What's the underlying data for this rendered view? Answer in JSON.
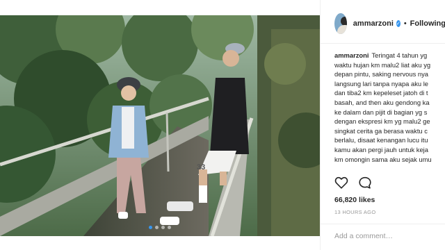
{
  "post": {
    "username": "ammarzoni",
    "verified_glyph": "✓",
    "separator": "•",
    "follow_label": "Following",
    "caption_lines": [
      "Teringat 4 tahun yg",
      "waktu hujan km malu2 liat aku yg",
      "depan pintu, saking nervous nya",
      "langsung lari tanpa nyapa aku le",
      "dan tiba2 km kepeleset jatoh di t",
      "basah, and then aku gendong ka",
      "ke dalam dan pijit di bagian yg s",
      "dengan ekspresi km yg malu2 ge",
      "singkat cerita ga berasa waktu c",
      "berlalu, disaat kenangan lucu itu",
      "kamu akan pergi jauh untuk keja",
      "km omongin sama aku sejak umu"
    ],
    "likes": "66,820 likes",
    "time": "13 HOURS AGO",
    "comment_placeholder": "Add a comment…"
  },
  "photo": {
    "carousel_count": 4,
    "carousel_active_index": 0,
    "shorts_number": "33"
  },
  "icons": {
    "like": "heart-icon",
    "comment": "comment-icon",
    "verified": "verified-badge-icon"
  },
  "colors": {
    "accent": "#3897f0",
    "text": "#262626",
    "muted": "#999999"
  }
}
